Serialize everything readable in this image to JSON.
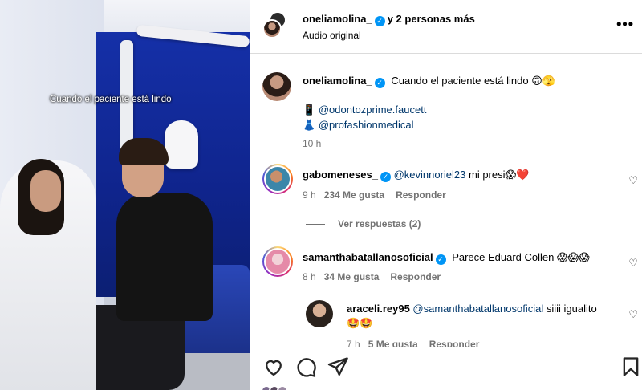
{
  "media": {
    "caption": "Cuando el paciente está lindo"
  },
  "header": {
    "username": "oneliamolina_",
    "collab": "y 2 personas más",
    "audio": "Audio original",
    "more": "•••"
  },
  "post": {
    "username": "oneliamolina_",
    "text": "Cuando el paciente está lindo",
    "text_emoji": "🙃🫣",
    "line1_icon": "📱",
    "line1_mention": "@odontozprime.faucett",
    "line2_icon": "👗",
    "line2_mention": "@profashionmedical",
    "time": "10 h"
  },
  "comments": [
    {
      "username": "gabomeneses_",
      "mention": "@kevinnoriel23",
      "text": "mi presi",
      "emoji": "😱❤️",
      "time": "9 h",
      "likes": "234 Me gusta",
      "reply": "Responder",
      "view_replies": "Ver respuestas (2)"
    },
    {
      "username": "samanthabatallanosoficial",
      "text": "Parece Eduard Collen",
      "emoji": "😱😱😱",
      "time": "8 h",
      "likes": "34 Me gusta",
      "reply": "Responder"
    },
    {
      "username": "araceli.rey95",
      "mention": "@samanthabatallanosoficial",
      "text": "siiii igualito",
      "emoji": "🤩🤩",
      "time": "7 h",
      "likes": "5 Me gusta",
      "reply": "Responder"
    }
  ],
  "icons": {
    "like": "heart-icon",
    "comment": "comment-icon",
    "share": "share-icon",
    "save": "bookmark-icon",
    "comment_like": "heart-icon"
  },
  "colors": {
    "verified": "#0095f6",
    "mention": "#00376b",
    "meta": "#737373",
    "divider": "#dbdbdb"
  }
}
